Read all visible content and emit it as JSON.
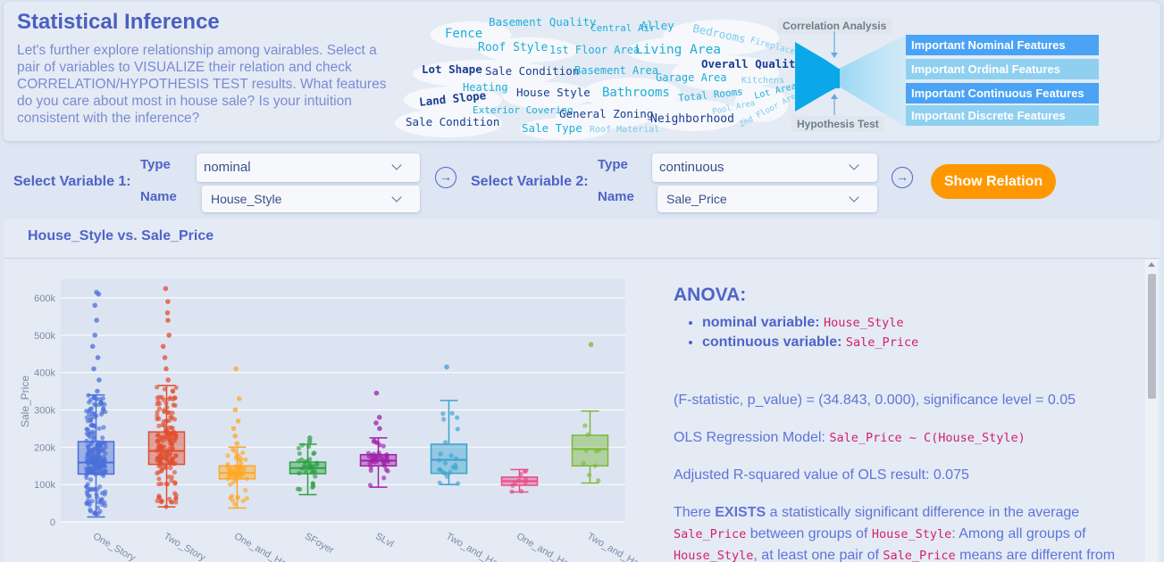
{
  "header": {
    "title": "Statistical Inference",
    "intro": "Let's further explore relationship among vairables. Select a pair of variables to VISUALIZE their relation and check CORRELATION/HYPOTHESIS TEST results. What features do you care about most in house sale? Is your intuition consistent with the inference?"
  },
  "word_cloud": [
    "Basement Quality",
    "Central Air",
    "Alley",
    "Bedrooms",
    "Fireplaces",
    "Fence",
    "Roof Style",
    "1st Floor Area",
    "Living Area",
    "Overall Quality",
    "Lot Shape",
    "Sale Condition",
    "Basement Area",
    "Garage Area",
    "Kitchens",
    "Heating",
    "House Style",
    "Bathrooms",
    "Total Rooms",
    "Lot Area",
    "Land Slope",
    "Exterior Covering",
    "General Zoning",
    "Pool Area",
    "2nd Floor Area",
    "Sale Condition",
    "Neighborhood",
    "Sale Type",
    "Roof Material"
  ],
  "funnel": {
    "top_label": "Correlation Analysis",
    "bottom_label": "Hypothesis Test",
    "features": [
      "Important Nominal Features",
      "Important Ordinal Features",
      "Important Continuous Features",
      "Important Discrete Features"
    ]
  },
  "controls": {
    "var1_label": "Select Variable 1:",
    "var2_label": "Select Variable 2:",
    "type_label": "Type",
    "name_label": "Name",
    "var1_type": "nominal",
    "var1_name": "House_Style",
    "var2_type": "continuous",
    "var2_name": "Sale_Price",
    "show_button": "Show Relation"
  },
  "result": {
    "title": "House_Style vs. Sale_Price",
    "anova_heading": "ANOVA:",
    "nominal_label": "nominal variable:",
    "nominal_value": "House_Style",
    "continuous_label": "continuous variable:",
    "continuous_value": "Sale_Price",
    "f_stat_text": "(F-statistic, p_value) = (34.843, 0.000), significance level = 0.05",
    "ols_prefix": "OLS Regression Model:",
    "ols_formula": "Sale_Price ~ C(House_Style)",
    "r2_text": "Adjusted R-squared value of OLS result: 0.075",
    "conclusion_1": "There",
    "conclusion_exists": "EXISTS",
    "conclusion_2": "a statistically significant difference in the average",
    "conclusion_var": "Sale_Price",
    "conclusion_3": "between groups of",
    "conclusion_group": "House_Style",
    "conclusion_4": ": Among all groups of",
    "conclusion_group2": "House_Style",
    "conclusion_5": ", at least one pair of",
    "conclusion_var2": "Sale_Price",
    "conclusion_6": "means are different from"
  },
  "chart_data": {
    "type": "box",
    "ylabel": "Sale_Price",
    "ylim": [
      0,
      650000
    ],
    "yticks": [
      "0",
      "100k",
      "200k",
      "300k",
      "400k",
      "500k",
      "600k"
    ],
    "categories": [
      "One_Story",
      "Two_Story",
      "One_and_Half_Fin",
      "SFoyer",
      "SLvl",
      "Two_and_Half_Unf",
      "One_and_Half_Unf",
      "Two_and_Half_Fin"
    ],
    "tick_labels": [
      "One_Story",
      "Two_Story",
      "One_and_Ha",
      "SFoyer",
      "SLvl",
      "Two_and_Ha",
      "One_and_Ha",
      "Two_and_Ha"
    ],
    "colors": [
      "#4a6fd8",
      "#e04e2e",
      "#ffa726",
      "#2ea043",
      "#a020a8",
      "#3aa3cf",
      "#e84b86",
      "#7cb83a"
    ],
    "boxes": [
      {
        "min": 13000,
        "q1": 128000,
        "median": 159000,
        "q3": 215000,
        "max": 340000,
        "outliers": [
          350000,
          380000,
          410000,
          440000,
          470000,
          500000,
          540000,
          580000,
          610000,
          615000
        ]
      },
      {
        "min": 40000,
        "q1": 154000,
        "median": 190000,
        "q3": 241000,
        "max": 365000,
        "outliers": [
          380000,
          410000,
          440000,
          470000,
          500000,
          540000,
          560000,
          590000,
          625000
        ]
      },
      {
        "min": 37000,
        "q1": 115000,
        "median": 131000,
        "q3": 150000,
        "max": 200000,
        "outliers": [
          210000,
          230000,
          250000,
          270000,
          300000,
          330000,
          410000
        ]
      },
      {
        "min": 73000,
        "q1": 129000,
        "median": 144000,
        "q3": 160000,
        "max": 208000,
        "outliers": [
          215000,
          225000
        ]
      },
      {
        "min": 93000,
        "q1": 150000,
        "median": 164000,
        "q3": 180000,
        "max": 225000,
        "outliers": [
          250000,
          265000,
          280000,
          345000
        ]
      },
      {
        "min": 100000,
        "q1": 130000,
        "median": 166000,
        "q3": 208000,
        "max": 325000,
        "outliers": [
          415000
        ]
      },
      {
        "min": 80000,
        "q1": 98000,
        "median": 109000,
        "q3": 120000,
        "max": 140000,
        "outliers": []
      },
      {
        "min": 104000,
        "q1": 150000,
        "median": 195000,
        "q3": 232000,
        "max": 297000,
        "outliers": [
          475000
        ]
      }
    ]
  }
}
